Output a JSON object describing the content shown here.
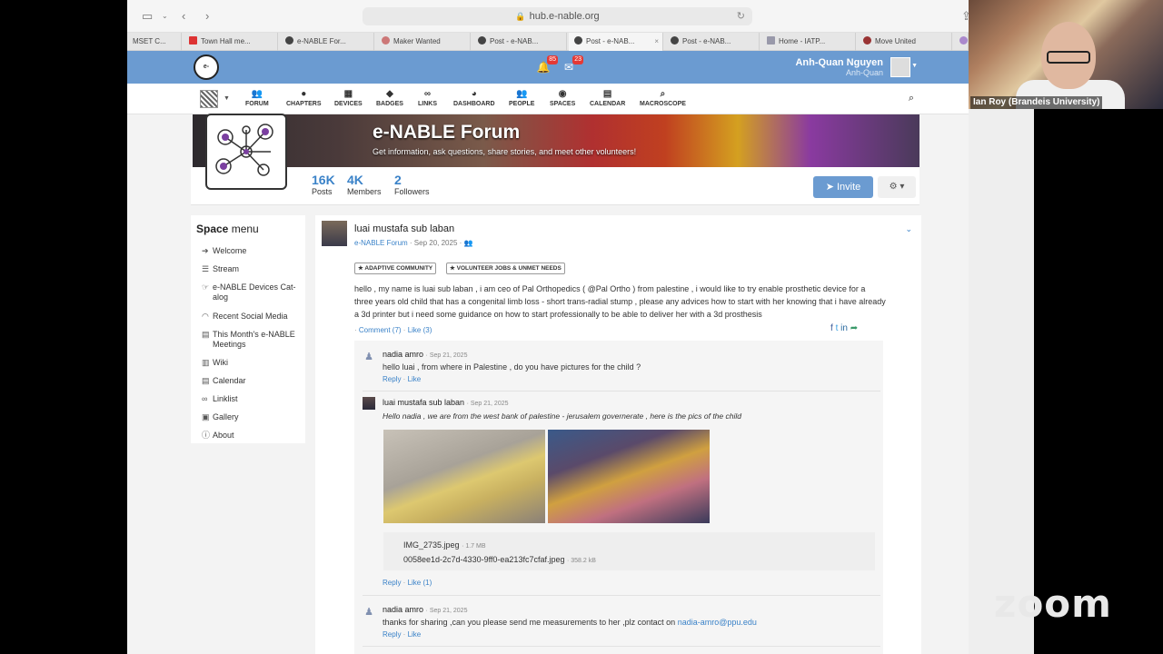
{
  "browser": {
    "url": "hub.e-nable.org",
    "tabs": [
      {
        "label": "MSET C..."
      },
      {
        "label": "Town Hall me..."
      },
      {
        "label": "e-NABLE For..."
      },
      {
        "label": "Maker Wanted"
      },
      {
        "label": "Post - e-NAB..."
      },
      {
        "label": "Post - e-NAB...",
        "active": true
      },
      {
        "label": "Post - e-NAB..."
      },
      {
        "label": "Home - IATP..."
      },
      {
        "label": "Move United"
      }
    ]
  },
  "header": {
    "logo_text": "e-NABLE",
    "notifications_count": "85",
    "messages_count": "23",
    "user_name": "Anh-Quan Nguyen",
    "user_handle": "Anh-Quan"
  },
  "nav": {
    "items": [
      {
        "label": "FORUM",
        "icon": "users-icon"
      },
      {
        "label": "CHAPTERS",
        "icon": "globe-icon"
      },
      {
        "label": "DEVICES",
        "icon": "cubes-icon"
      },
      {
        "label": "BADGES",
        "icon": "tags-icon"
      },
      {
        "label": "LINKS",
        "icon": "link-icon"
      },
      {
        "label": "DASHBOARD",
        "icon": "dashboard-icon"
      },
      {
        "label": "PEOPLE",
        "icon": "users-icon"
      },
      {
        "label": "SPACES",
        "icon": "dot-circle-icon"
      },
      {
        "label": "CALENDAR",
        "icon": "calendar-icon"
      },
      {
        "label": "MACROSCOPE",
        "icon": "search-icon"
      }
    ]
  },
  "space": {
    "title": "e-NABLE Forum",
    "subtitle": "Get information, ask questions, share stories, and meet other volunteers!",
    "stats": [
      {
        "value": "16K",
        "label": "Posts"
      },
      {
        "value": "4K",
        "label": "Members"
      },
      {
        "value": "2",
        "label": "Followers"
      }
    ],
    "invite_label": "Invite"
  },
  "menu": {
    "title_bold": "Space",
    "title_rest": " menu",
    "items": [
      {
        "label": "Welcome",
        "icon": "arrow-right-icon"
      },
      {
        "label": "Stream",
        "icon": "bars-icon"
      },
      {
        "label": "e-NABLE Devices Cat-alog",
        "icon": "hand-icon"
      },
      {
        "label": "Recent Social Media",
        "icon": "rss-icon"
      },
      {
        "label": "This Month's e-NABLE Meetings",
        "icon": "calendar-icon"
      },
      {
        "label": "Wiki",
        "icon": "book-icon"
      },
      {
        "label": "Calendar",
        "icon": "calendar-icon"
      },
      {
        "label": "Linklist",
        "icon": "link-icon"
      },
      {
        "label": "Gallery",
        "icon": "image-icon"
      },
      {
        "label": "About",
        "icon": "info-icon"
      }
    ]
  },
  "post": {
    "author": "luai mustafa sub laban",
    "space_link": "e-NABLE Forum",
    "date": "· Sep 20, 2025 ·",
    "tags": [
      "★ ADAPTIVE COMMUNITY",
      "★ VOLUNTEER JOBS & UNMET NEEDS"
    ],
    "body": "hello , my name is luai sub laban , i am ceo of Pal Orthopedics ( @Pal Ortho ) from palestine , i would like to try enable prosthetic device for a three years old child that has a congenital limb loss - short trans-radial stump , please any advices how to start with her knowing that i have already a 3d printer but i need some guidance on how to start professionally to be able to deliver her with a 3d prosthesis",
    "comment_label": "Comment (7)",
    "like_label": "Like (3)",
    "comments": [
      {
        "author": "nadia amro",
        "date": "· Sep 21, 2025",
        "text": "hello luai , from where in Palestine , do you have pictures for the child ?",
        "reply": "Reply",
        "like": "Like"
      },
      {
        "author": "luai mustafa sub laban",
        "date": "· Sep 21, 2025",
        "text": "Hello nadia , we are from the west bank of palestine - jerusalem governerate , here is the pics of the child",
        "files": [
          {
            "name": "IMG_2735.jpeg",
            "size": "· 1.7 MB"
          },
          {
            "name": "0058ee1d-2c7d-4330-9ff0-ea213fc7cfaf.jpeg",
            "size": "· 358.2 kB"
          }
        ],
        "reply": "Reply",
        "like": "Like (1)"
      },
      {
        "author": "nadia amro",
        "date": "· Sep 21, 2025",
        "text": "thanks for sharing ,can you please send me measurements to her ,plz contact on ",
        "email": "nadia-amro@ppu.edu",
        "reply": "Reply",
        "like": "Like"
      }
    ]
  },
  "video": {
    "participant": "Ian Roy (Brandeis University)",
    "zoom_logo": "zoom"
  }
}
